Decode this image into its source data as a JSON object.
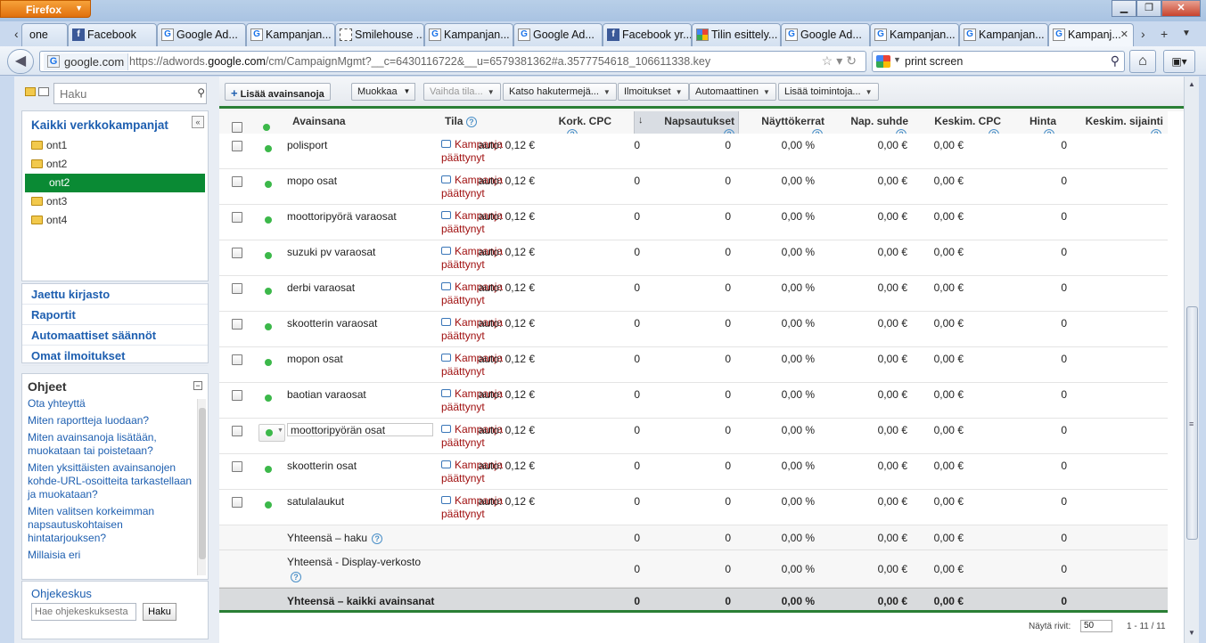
{
  "browser": {
    "menu_label": "Firefox",
    "tabs": [
      {
        "label": "one",
        "icon": "partial"
      },
      {
        "label": "Facebook",
        "icon": "fb"
      },
      {
        "label": "Google Ad...",
        "icon": "g"
      },
      {
        "label": "Kampanjan...",
        "icon": "g"
      },
      {
        "label": "Smilehouse ...",
        "icon": "dash"
      },
      {
        "label": "Kampanjan...",
        "icon": "g"
      },
      {
        "label": "Google Ad...",
        "icon": "g"
      },
      {
        "label": "Facebook yr...",
        "icon": "fb"
      },
      {
        "label": "Tilin esittely...",
        "icon": "google"
      },
      {
        "label": "Google Ad...",
        "icon": "g"
      },
      {
        "label": "Kampanjan...",
        "icon": "g"
      },
      {
        "label": "Kampanjan...",
        "icon": "g"
      },
      {
        "label": "Kampanj...",
        "icon": "g",
        "active": true
      }
    ],
    "url_site": "google.com",
    "url_prefix": "https://adwords.",
    "url_domain": "google.com",
    "url_suffix": "/cm/CampaignMgmt?__c=6430116722&__u=6579381362#a.3577754618_106611338.key",
    "search_value": "print screen"
  },
  "sidebar": {
    "search_placeholder": "Haku",
    "tree_title": "Kaikki verkkokampanjat",
    "campaigns": [
      {
        "label": "ont1",
        "selected": false
      },
      {
        "label": "ont2",
        "selected": false
      },
      {
        "label": "ont2",
        "selected": true
      },
      {
        "label": "ont3",
        "selected": false
      },
      {
        "label": "ont4",
        "selected": false
      }
    ],
    "links": [
      "Jaettu kirjasto",
      "Raportit",
      "Automaattiset säännöt",
      "Omat ilmoitukset"
    ],
    "help_title": "Ohjeet",
    "help_links": [
      "Ota yhteyttä",
      "Miten raportteja luodaan?",
      "Miten avainsanoja lisätään, muokataan tai poistetaan?",
      "Miten yksittäisten avainsanojen kohde-URL-osoitteita tarkastellaan ja muokataan?",
      "Miten valitsen korkeimman napsautuskohtaisen hintatarjouksen?",
      "Millaisia eri"
    ],
    "help_center_title": "Ohjekeskus",
    "help_center_placeholder": "Hae ohjekeskuksesta",
    "help_center_button": "Haku"
  },
  "toolbar": {
    "add_keywords": "Lisää avainsanoja",
    "edit": "Muokkaa",
    "change_status": "Vaihda tila...",
    "search_terms": "Katso hakutermejä...",
    "ads": "Ilmoitukset",
    "automatic": "Automaattinen",
    "more_actions": "Lisää toimintoja..."
  },
  "table": {
    "headers": {
      "keyword": "Avainsana",
      "status": "Tila",
      "max_cpc": "Kork. CPC",
      "clicks": "Napsautukset",
      "impressions": "Näyttökerrat",
      "ctr": "Nap. suhde",
      "avg_cpc": "Keskim. CPC",
      "cost": "Hinta",
      "avg_pos": "Keskim. sijainti"
    },
    "rows": [
      {
        "keyword": "polisport",
        "status1": "Kampanja",
        "status2": "päättynyt",
        "max_cpc": "auto: 0,12 €",
        "clicks": "0",
        "impr": "0",
        "ctr": "0,00 %",
        "avg_cpc": "0,00 €",
        "cost": "0,00 €",
        "pos": "0"
      },
      {
        "keyword": "mopo osat",
        "status1": "Kampanja",
        "status2": "päättynyt",
        "max_cpc": "auto: 0,12 €",
        "clicks": "0",
        "impr": "0",
        "ctr": "0,00 %",
        "avg_cpc": "0,00 €",
        "cost": "0,00 €",
        "pos": "0"
      },
      {
        "keyword": "moottoripyörä varaosat",
        "status1": "Kampanja",
        "status2": "päättynyt",
        "max_cpc": "auto: 0,12 €",
        "clicks": "0",
        "impr": "0",
        "ctr": "0,00 %",
        "avg_cpc": "0,00 €",
        "cost": "0,00 €",
        "pos": "0"
      },
      {
        "keyword": "suzuki pv varaosat",
        "status1": "Kampanja",
        "status2": "päättynyt",
        "max_cpc": "auto: 0,12 €",
        "clicks": "0",
        "impr": "0",
        "ctr": "0,00 %",
        "avg_cpc": "0,00 €",
        "cost": "0,00 €",
        "pos": "0"
      },
      {
        "keyword": "derbi varaosat",
        "status1": "Kampanja",
        "status2": "päättynyt",
        "max_cpc": "auto: 0,12 €",
        "clicks": "0",
        "impr": "0",
        "ctr": "0,00 %",
        "avg_cpc": "0,00 €",
        "cost": "0,00 €",
        "pos": "0"
      },
      {
        "keyword": "skootterin varaosat",
        "status1": "Kampanja",
        "status2": "päättynyt",
        "max_cpc": "auto: 0,12 €",
        "clicks": "0",
        "impr": "0",
        "ctr": "0,00 %",
        "avg_cpc": "0,00 €",
        "cost": "0,00 €",
        "pos": "0"
      },
      {
        "keyword": "mopon osat",
        "status1": "Kampanja",
        "status2": "päättynyt",
        "max_cpc": "auto: 0,12 €",
        "clicks": "0",
        "impr": "0",
        "ctr": "0,00 %",
        "avg_cpc": "0,00 €",
        "cost": "0,00 €",
        "pos": "0"
      },
      {
        "keyword": "baotian varaosat",
        "status1": "Kampanja",
        "status2": "päättynyt",
        "max_cpc": "auto: 0,12 €",
        "clicks": "0",
        "impr": "0",
        "ctr": "0,00 %",
        "avg_cpc": "0,00 €",
        "cost": "0,00 €",
        "pos": "0"
      },
      {
        "keyword": "moottoripyörän osat",
        "status1": "Kampanja",
        "status2": "päättynyt",
        "max_cpc": "auto: 0,12 €",
        "clicks": "0",
        "impr": "0",
        "ctr": "0,00 %",
        "avg_cpc": "0,00 €",
        "cost": "0,00 €",
        "pos": "0",
        "editing": true
      },
      {
        "keyword": "skootterin osat",
        "status1": "Kampanja",
        "status2": "päättynyt",
        "max_cpc": "auto: 0,12 €",
        "clicks": "0",
        "impr": "0",
        "ctr": "0,00 %",
        "avg_cpc": "0,00 €",
        "cost": "0,00 €",
        "pos": "0"
      },
      {
        "keyword": "satulalaukut",
        "status1": "Kampanja",
        "status2": "päättynyt",
        "max_cpc": "auto: 0,12 €",
        "clicks": "0",
        "impr": "0",
        "ctr": "0,00 %",
        "avg_cpc": "0,00 €",
        "cost": "0,00 €",
        "pos": "0"
      }
    ],
    "totals": [
      {
        "label": "Yhteensä – haku",
        "help": true,
        "clicks": "0",
        "impr": "0",
        "ctr": "0,00 %",
        "avg_cpc": "0,00 €",
        "cost": "0,00 €",
        "pos": "0"
      },
      {
        "label": "Yhteensä - Display-verkosto",
        "help": true,
        "clicks": "0",
        "impr": "0",
        "ctr": "0,00 %",
        "avg_cpc": "0,00 €",
        "cost": "0,00 €",
        "pos": "0"
      },
      {
        "label": "Yhteensä – kaikki avainsanat",
        "help": false,
        "clicks": "0",
        "impr": "0",
        "ctr": "0,00 %",
        "avg_cpc": "0,00 €",
        "cost": "0,00 €",
        "pos": "0"
      }
    ],
    "pager": {
      "label": "Näytä rivit:",
      "page_size": "50",
      "range": "1 - 11 / 11"
    }
  }
}
